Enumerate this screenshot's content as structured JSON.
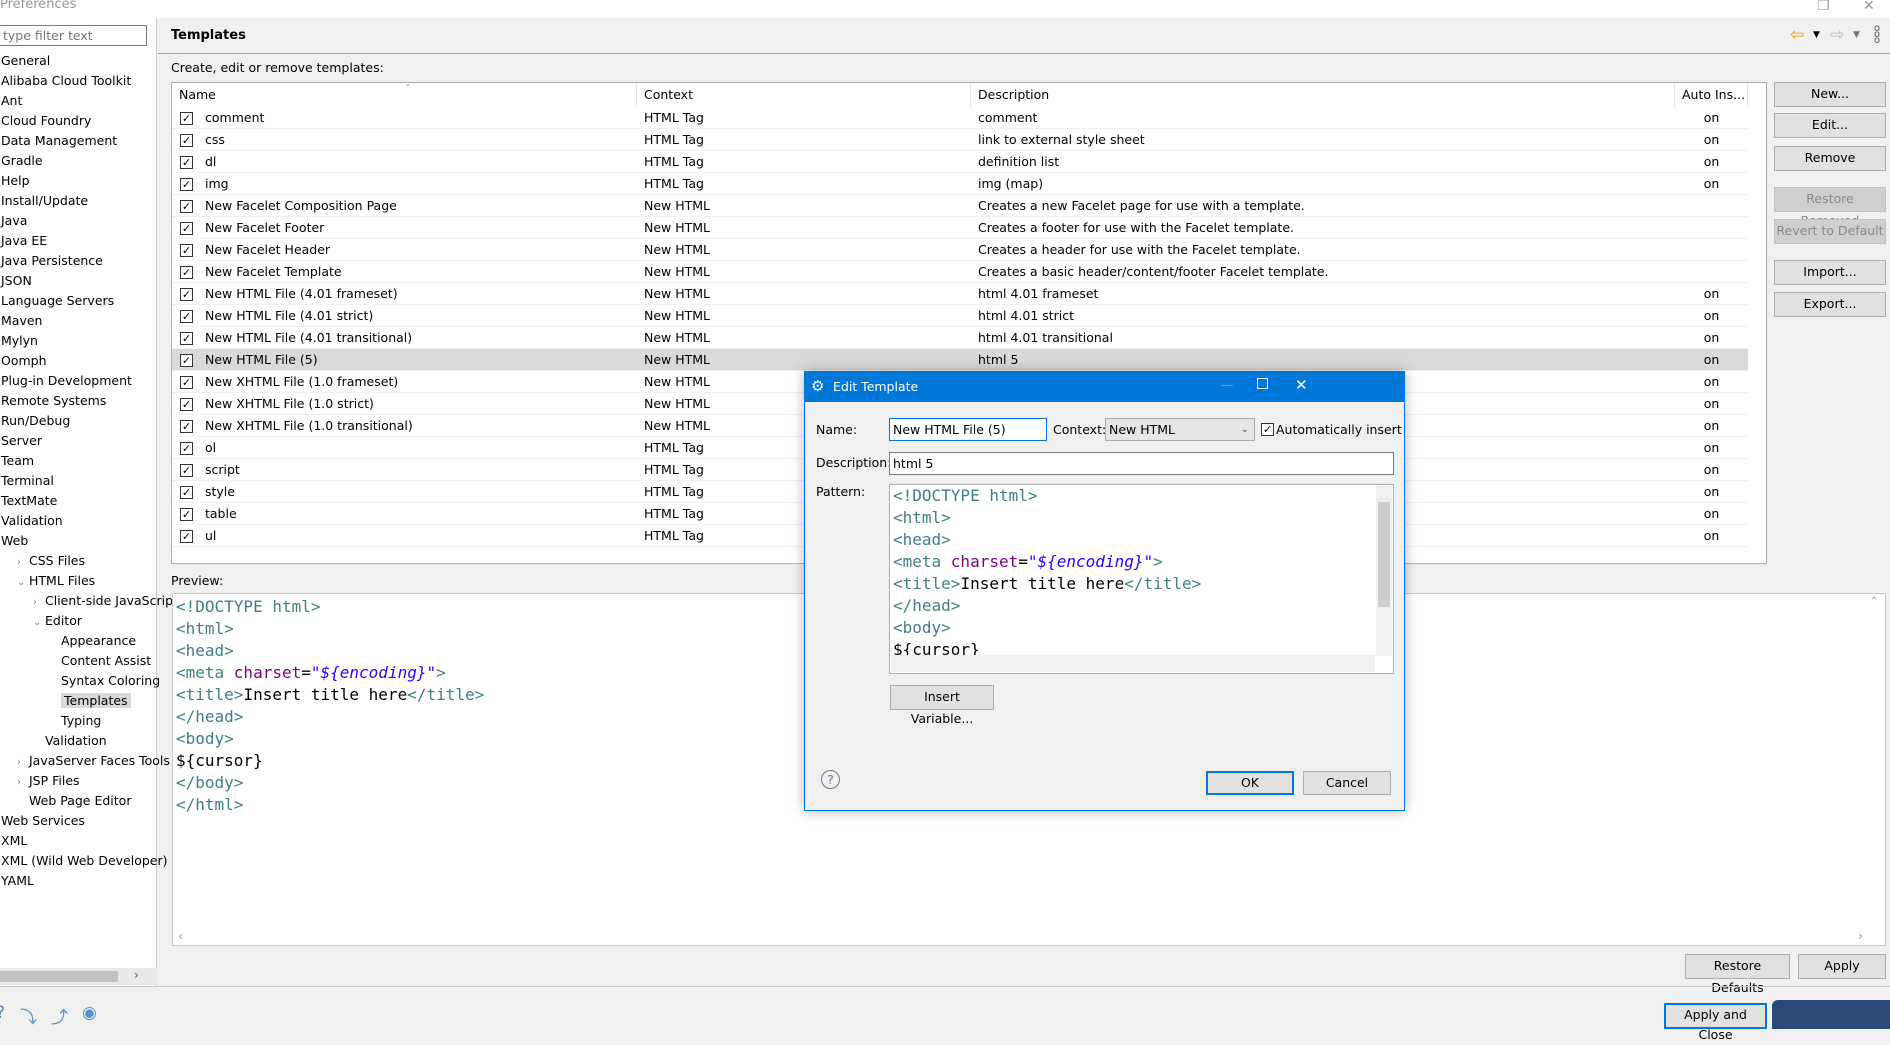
{
  "window": {
    "title": "Preferences"
  },
  "sidebar": {
    "filter_placeholder": "type filter text",
    "items": [
      {
        "label": "General",
        "level": 0,
        "tw": ""
      },
      {
        "label": "Alibaba Cloud Toolkit",
        "level": 0,
        "tw": ""
      },
      {
        "label": "Ant",
        "level": 0,
        "tw": ""
      },
      {
        "label": "Cloud Foundry",
        "level": 0,
        "tw": ""
      },
      {
        "label": "Data Management",
        "level": 0,
        "tw": ""
      },
      {
        "label": "Gradle",
        "level": 0,
        "tw": ""
      },
      {
        "label": "Help",
        "level": 0,
        "tw": ""
      },
      {
        "label": "Install/Update",
        "level": 0,
        "tw": ""
      },
      {
        "label": "Java",
        "level": 0,
        "tw": ""
      },
      {
        "label": "Java EE",
        "level": 0,
        "tw": ""
      },
      {
        "label": "Java Persistence",
        "level": 0,
        "tw": ""
      },
      {
        "label": "JSON",
        "level": 0,
        "tw": ""
      },
      {
        "label": "Language Servers",
        "level": 0,
        "tw": ""
      },
      {
        "label": "Maven",
        "level": 0,
        "tw": ""
      },
      {
        "label": "Mylyn",
        "level": 0,
        "tw": ""
      },
      {
        "label": "Oomph",
        "level": 0,
        "tw": ""
      },
      {
        "label": "Plug-in Development",
        "level": 0,
        "tw": ""
      },
      {
        "label": "Remote Systems",
        "level": 0,
        "tw": ""
      },
      {
        "label": "Run/Debug",
        "level": 0,
        "tw": ""
      },
      {
        "label": "Server",
        "level": 0,
        "tw": ""
      },
      {
        "label": "Team",
        "level": 0,
        "tw": ""
      },
      {
        "label": "Terminal",
        "level": 0,
        "tw": ""
      },
      {
        "label": "TextMate",
        "level": 0,
        "tw": ""
      },
      {
        "label": "Validation",
        "level": 0,
        "tw": ""
      },
      {
        "label": "Web",
        "level": 0,
        "tw": ""
      },
      {
        "label": "CSS Files",
        "level": 1,
        "tw": "collapsed"
      },
      {
        "label": "HTML Files",
        "level": 1,
        "tw": "expanded"
      },
      {
        "label": "Client-side JavaScript",
        "level": 2,
        "tw": "collapsed"
      },
      {
        "label": "Editor",
        "level": 2,
        "tw": "expanded"
      },
      {
        "label": "Appearance",
        "level": 3,
        "tw": ""
      },
      {
        "label": "Content Assist",
        "level": 3,
        "tw": ""
      },
      {
        "label": "Syntax Coloring",
        "level": 3,
        "tw": ""
      },
      {
        "label": "Templates",
        "level": 3,
        "tw": "",
        "selected": true
      },
      {
        "label": "Typing",
        "level": 3,
        "tw": ""
      },
      {
        "label": "Validation",
        "level": 2,
        "tw": ""
      },
      {
        "label": "JavaServer Faces Tools",
        "level": 1,
        "tw": "collapsed"
      },
      {
        "label": "JSP Files",
        "level": 1,
        "tw": "collapsed"
      },
      {
        "label": "Web Page Editor",
        "level": 1,
        "tw": ""
      },
      {
        "label": "Web Services",
        "level": 0,
        "tw": ""
      },
      {
        "label": "XML",
        "level": 0,
        "tw": ""
      },
      {
        "label": "XML (Wild Web Developer)",
        "level": 0,
        "tw": ""
      },
      {
        "label": "YAML",
        "level": 0,
        "tw": ""
      }
    ]
  },
  "main": {
    "title": "Templates",
    "subtitle": "Create, edit or remove templates:",
    "columns": [
      "Name",
      "Context",
      "Description",
      "Auto Ins..."
    ],
    "rows": [
      {
        "name": "comment",
        "context": "HTML Tag",
        "description": "comment",
        "auto": "on"
      },
      {
        "name": "css",
        "context": "HTML Tag",
        "description": "link to external style sheet",
        "auto": "on"
      },
      {
        "name": "dl",
        "context": "HTML Tag",
        "description": "definition list",
        "auto": "on"
      },
      {
        "name": "img",
        "context": "HTML Tag",
        "description": "img     (map)",
        "auto": "on"
      },
      {
        "name": "New Facelet Composition Page",
        "context": "New HTML",
        "description": "Creates a new Facelet page for use with a template.",
        "auto": ""
      },
      {
        "name": "New Facelet Footer",
        "context": "New HTML",
        "description": "Creates a footer for use with the Facelet template.",
        "auto": ""
      },
      {
        "name": "New Facelet Header",
        "context": "New HTML",
        "description": "Creates a header for use with the Facelet template.",
        "auto": ""
      },
      {
        "name": "New Facelet Template",
        "context": "New HTML",
        "description": "Creates a basic header/content/footer Facelet template.",
        "auto": ""
      },
      {
        "name": "New HTML File (4.01 frameset)",
        "context": "New HTML",
        "description": "html 4.01 frameset",
        "auto": "on"
      },
      {
        "name": "New HTML File (4.01 strict)",
        "context": "New HTML",
        "description": "html 4.01 strict",
        "auto": "on"
      },
      {
        "name": "New HTML File (4.01 transitional)",
        "context": "New HTML",
        "description": "html 4.01 transitional",
        "auto": "on"
      },
      {
        "name": "New HTML File (5)",
        "context": "New HTML",
        "description": "html 5",
        "auto": "on",
        "selected": true
      },
      {
        "name": "New XHTML File (1.0 frameset)",
        "context": "New HTML",
        "description": "",
        "auto": "on"
      },
      {
        "name": "New XHTML File (1.0 strict)",
        "context": "New HTML",
        "description": "",
        "auto": "on"
      },
      {
        "name": "New XHTML File (1.0 transitional)",
        "context": "New HTML",
        "description": "",
        "auto": "on"
      },
      {
        "name": "ol",
        "context": "HTML Tag",
        "description": "",
        "auto": "on"
      },
      {
        "name": "script",
        "context": "HTML Tag",
        "description": "",
        "auto": "on"
      },
      {
        "name": "style",
        "context": "HTML Tag",
        "description": "",
        "auto": "on"
      },
      {
        "name": "table",
        "context": "HTML Tag",
        "description": "",
        "auto": "on"
      },
      {
        "name": "ul",
        "context": "HTML Tag",
        "description": "",
        "auto": "on"
      }
    ],
    "buttons": {
      "new": "New...",
      "edit": "Edit...",
      "remove": "Remove",
      "restore_removed": "Restore Removed",
      "revert": "Revert to Default",
      "import": "Import...",
      "export": "Export..."
    },
    "preview_label": "Preview:",
    "restore_defaults": "Restore Defaults",
    "apply": "Apply",
    "apply_and_close": "Apply and Close"
  },
  "code": [
    [
      [
        "tag",
        "<!DOCTYPE html>"
      ]
    ],
    [
      [
        "tag",
        "<html>"
      ]
    ],
    [
      [
        "tag",
        "<head>"
      ]
    ],
    [
      [
        "tag",
        "<meta "
      ],
      [
        "attr",
        "charset"
      ],
      [
        "txt",
        "="
      ],
      [
        "val",
        "\"${encoding}\""
      ],
      [
        "tag",
        ">"
      ]
    ],
    [
      [
        "tag",
        "<title>"
      ],
      [
        "txt",
        "Insert title here"
      ],
      [
        "tag",
        "</title>"
      ]
    ],
    [
      [
        "tag",
        "</head>"
      ]
    ],
    [
      [
        "tag",
        "<body>"
      ]
    ],
    [
      [
        "txt",
        "${cursor}"
      ]
    ],
    [
      [
        "tag",
        "</body>"
      ]
    ],
    [
      [
        "tag",
        "</html>"
      ]
    ]
  ],
  "dialog": {
    "title": "Edit Template",
    "name_label": "Name:",
    "name_value": "New HTML File (5)",
    "context_label": "Context:",
    "context_value": "New HTML",
    "auto_insert_label": "Automatically insert",
    "description_label": "Description:",
    "description_value": "html 5",
    "pattern_label": "Pattern:",
    "insert_variable": "Insert Variable...",
    "ok": "OK",
    "cancel": "Cancel"
  },
  "colors": {
    "accent": "#0078d7",
    "tag": "#3f7f7f",
    "attr": "#7f007f",
    "value": "#2a00ff"
  }
}
